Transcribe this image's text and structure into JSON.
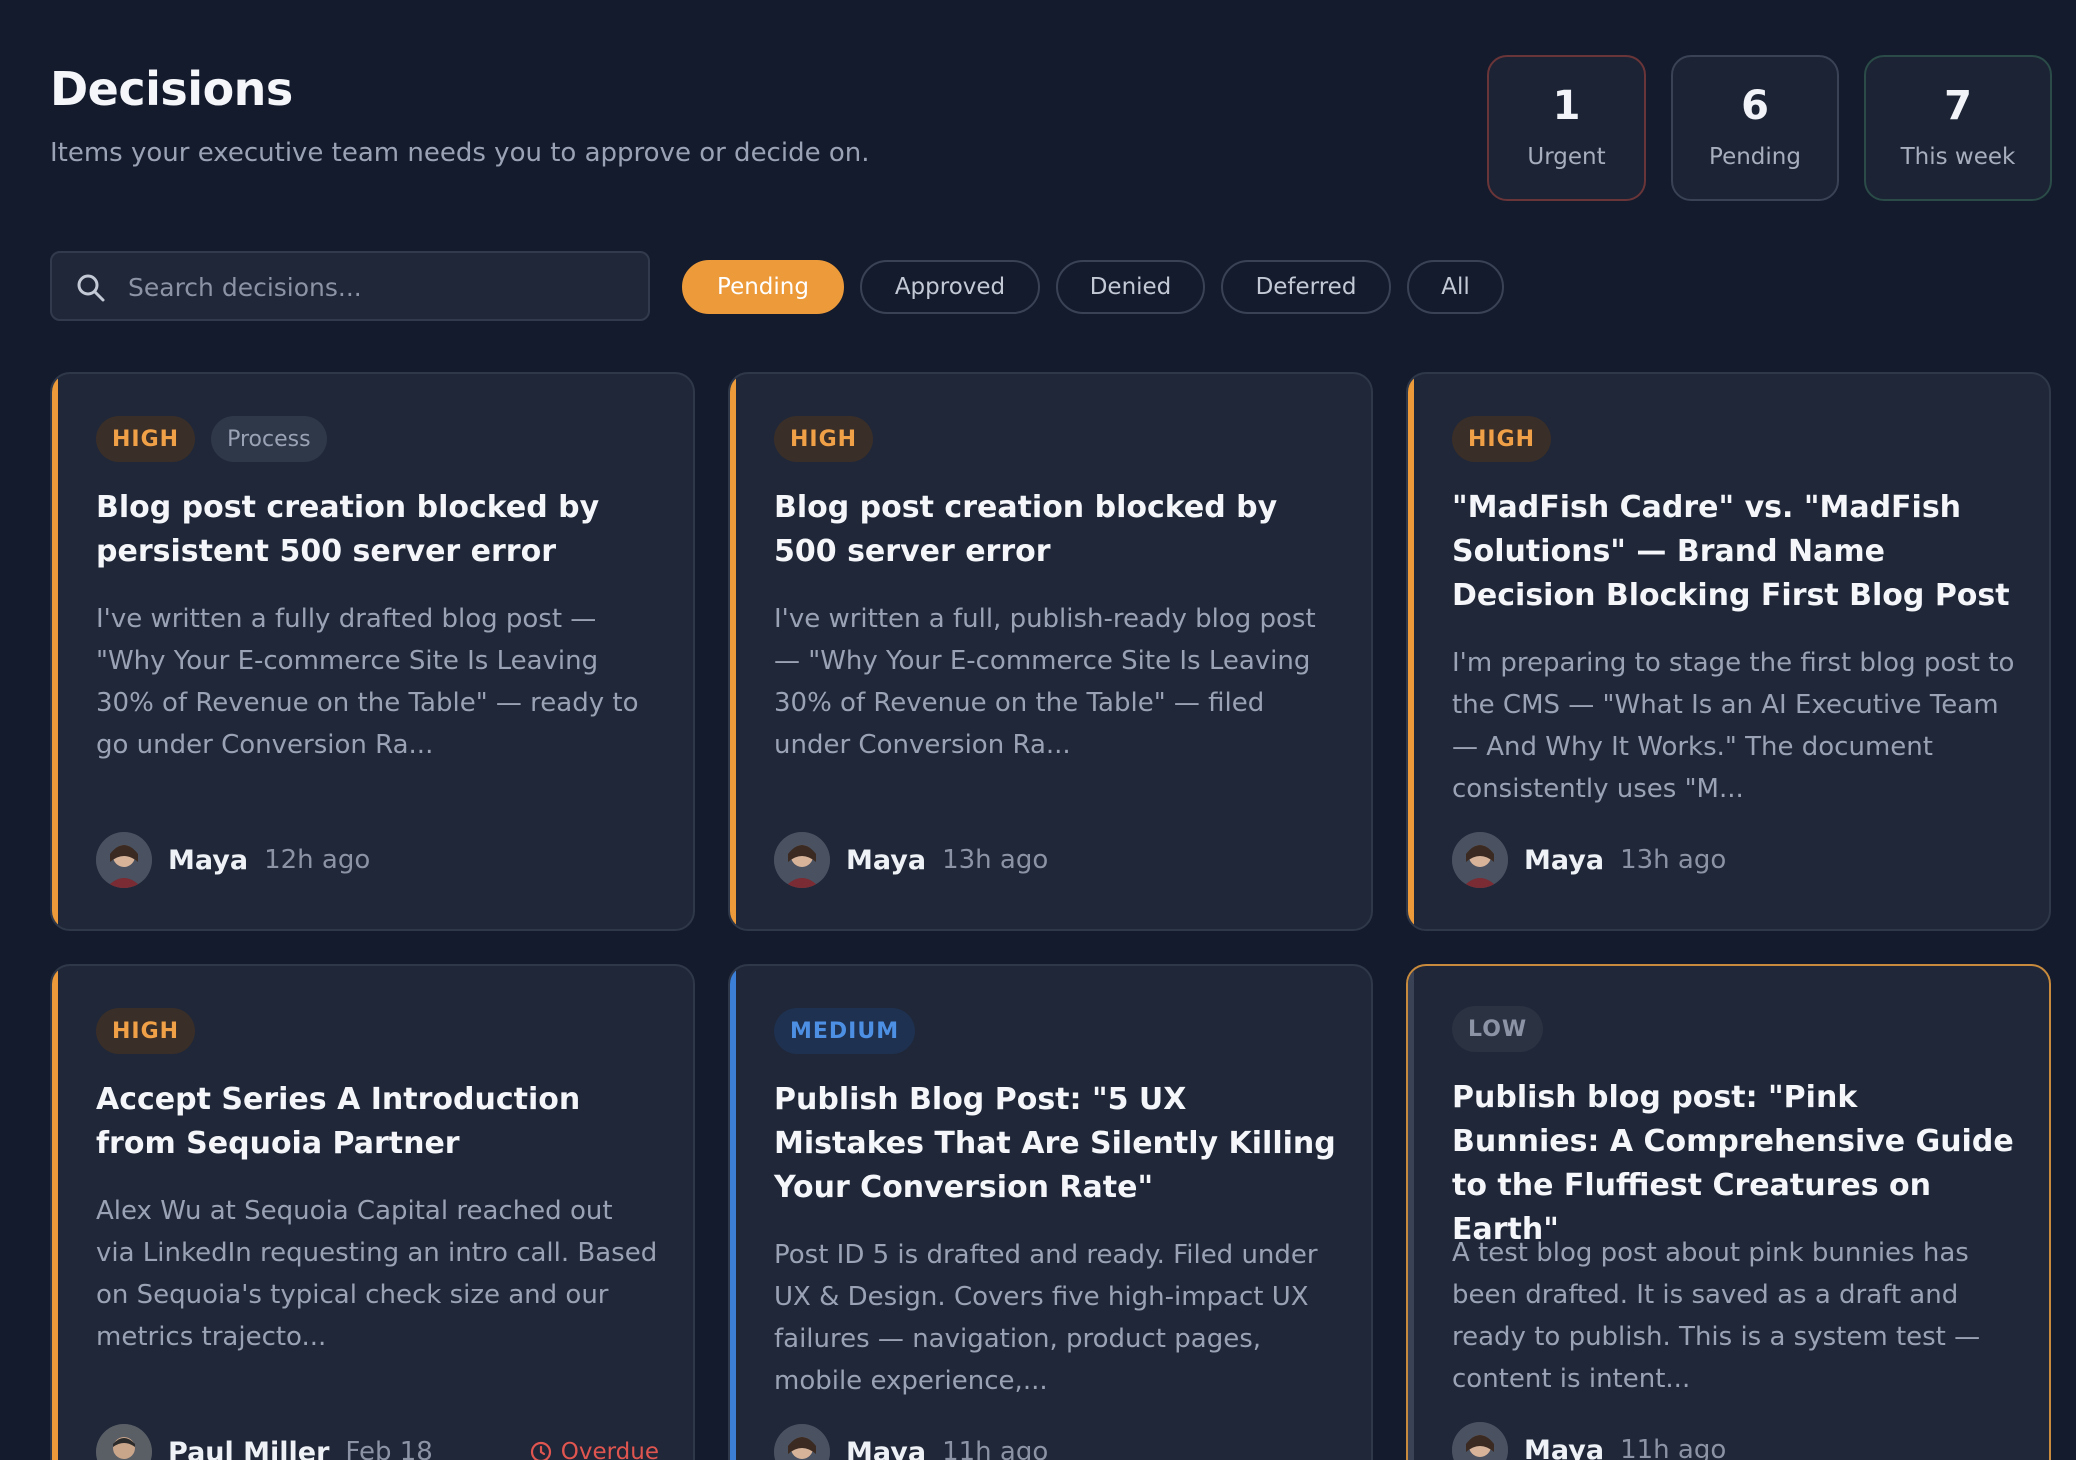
{
  "header": {
    "title": "Decisions",
    "subtitle": "Items your executive team needs you to approve or decide on."
  },
  "stats": [
    {
      "value": "1",
      "label": "Urgent",
      "border_color": "#6a3538"
    },
    {
      "value": "6",
      "label": "Pending",
      "border_color": "#3a4356"
    },
    {
      "value": "7",
      "label": "This week",
      "border_color": "#2a4b47"
    }
  ],
  "search": {
    "placeholder": "Search decisions...",
    "value": "",
    "icon": "search-icon"
  },
  "filters": [
    {
      "label": "Pending",
      "active": true
    },
    {
      "label": "Approved",
      "active": false
    },
    {
      "label": "Denied",
      "active": false
    },
    {
      "label": "Deferred",
      "active": false
    },
    {
      "label": "All",
      "active": false
    }
  ],
  "colors": {
    "accent": "#ec9a3a",
    "high": "#f0a046",
    "medium": "#4d8fe3",
    "low": "#8b93a5",
    "overdue": "#e0554f",
    "background": "#141b2d",
    "card": "#1f2738"
  },
  "cards": [
    {
      "priority": "HIGH",
      "tag": "Process",
      "title": "Blog post creation blocked by persistent 500 server error",
      "description": "I've written a fully drafted blog post — \"Why Your E-commerce Site Is Leaving 30% of Revenue on the Table\" — ready to go under Conversion Ra...",
      "author": "Maya",
      "time": "12h ago"
    },
    {
      "priority": "HIGH",
      "title": "Blog post creation blocked by 500 server error",
      "description": "I've written a full, publish-ready blog post — \"Why Your E-commerce Site Is Leaving 30% of Revenue on the Table\" — filed under Conversion Ra...",
      "author": "Maya",
      "time": "13h ago"
    },
    {
      "priority": "HIGH",
      "title": "\"MadFish Cadre\" vs. \"MadFish Solutions\" — Brand Name Decision Blocking First Blog Post",
      "description": "I'm preparing to stage the first blog post to the CMS — \"What Is an AI Executive Team — And Why It Works.\" The document consistently uses \"M...",
      "author": "Maya",
      "time": "13h ago"
    },
    {
      "priority": "HIGH",
      "title": "Accept Series A Introduction from Sequoia Partner",
      "description": "Alex Wu at Sequoia Capital reached out via LinkedIn requesting an intro call. Based on Sequoia's typical check size and our metrics trajecto...",
      "author": "Paul Miller",
      "time": "Feb 18",
      "status": "Overdue"
    },
    {
      "priority": "MEDIUM",
      "title": "Publish Blog Post: \"5 UX Mistakes That Are Silently Killing Your Conversion Rate\"",
      "description": "Post ID 5 is drafted and ready. Filed under UX & Design. Covers five high-impact UX failures — navigation, product pages, mobile experience,...",
      "author": "Maya",
      "time": "11h ago"
    },
    {
      "priority": "LOW",
      "title": "Publish blog post: \"Pink Bunnies: A Comprehensive Guide to the Fluffiest Creatures on Earth\"",
      "description": "A test blog post about pink bunnies has been drafted. It is saved as a draft and ready to publish. This is a system test — content is intent...",
      "author": "Maya",
      "time": "11h ago"
    }
  ]
}
